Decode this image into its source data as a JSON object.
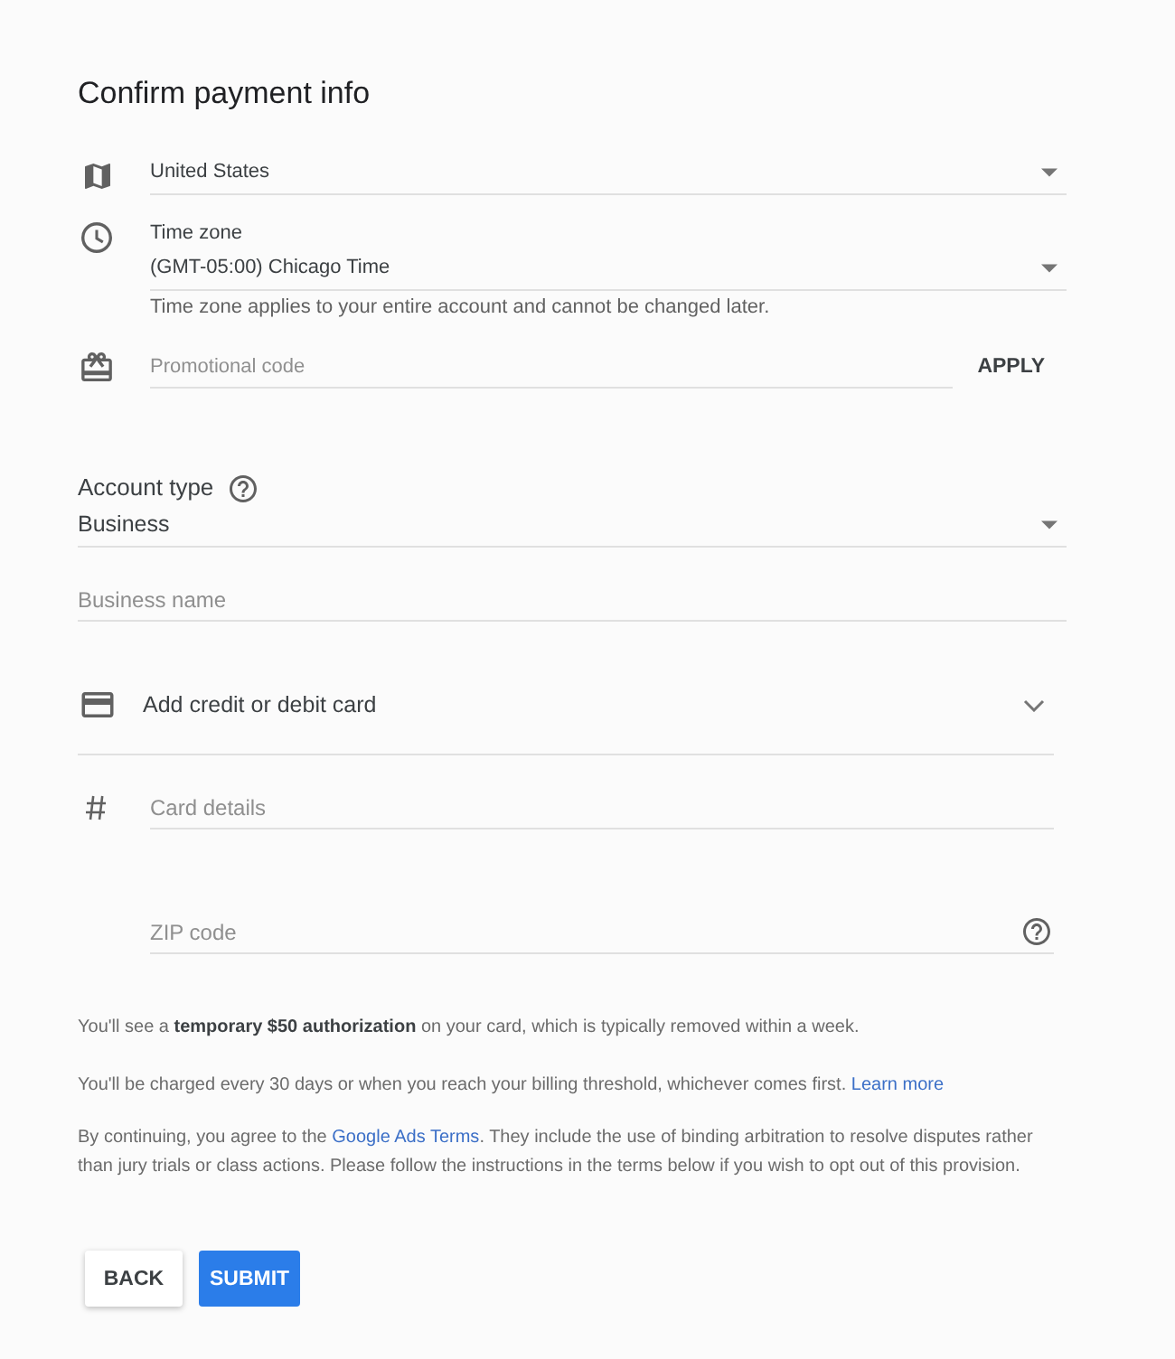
{
  "title": "Confirm payment info",
  "country": {
    "value": "United States"
  },
  "time_zone": {
    "label": "Time zone",
    "value": "(GMT-05:00) Chicago Time",
    "hint": "Time zone applies to your entire account and cannot be changed later."
  },
  "promo_code": {
    "placeholder": "Promotional code",
    "button": "APPLY"
  },
  "account_type": {
    "label": "Account type",
    "value": "Business"
  },
  "business_name": {
    "placeholder": "Business name"
  },
  "payment_method": {
    "label": "Add credit or debit card"
  },
  "card_details": {
    "placeholder": "Card details"
  },
  "zip_code": {
    "placeholder": "ZIP code"
  },
  "notices": [
    {
      "text": "You'll see a **temporary $50 authorization** on your card, which is typically removed within a week."
    },
    {
      "text": "You'll be charged every 30 days or when you reach your billing threshold, whichever comes first.",
      "link": "Learn more"
    },
    {
      "text": "By continuing, you agree to the",
      "link": "Google Ads Terms",
      "text_after": ". They include the use of binding arbitration to resolve disputes rather than jury trials or class actions. Please follow the instructions in the terms below if you wish to opt out of this provision."
    }
  ],
  "buttons": [
    {
      "label": "BACK",
      "kind": "secondary"
    },
    {
      "label": "SUBMIT",
      "kind": "primary"
    }
  ]
}
